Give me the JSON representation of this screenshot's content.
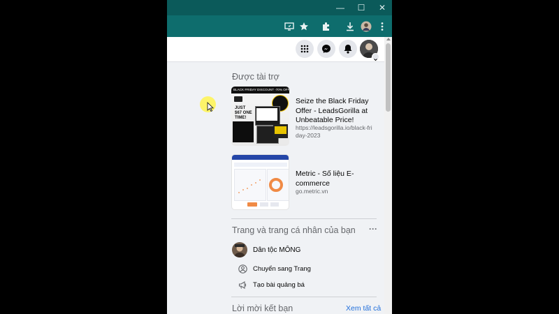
{
  "browser": {
    "window_controls": {
      "minimize": "—",
      "maximize": "☐",
      "close": "✕"
    },
    "toolbar_icons": [
      "install-app-icon",
      "bookmark-star-icon",
      "extensions-icon",
      "download-icon",
      "profile-avatar",
      "menu-icon"
    ],
    "theme_color": "#0e6d6d"
  },
  "facebook_header": {
    "icons": [
      "menu-grid-icon",
      "messenger-icon",
      "notifications-bell-icon",
      "account-avatar"
    ]
  },
  "sponsored": {
    "title": "Được tài trợ",
    "ads": [
      {
        "image_banner": "BLACK FRIDAY DISCOUNT -70% OFF",
        "image_headline": "JUST $67 ONE TIME!",
        "title": "Seize the Black Friday Offer - LeadsGorilla at Unbeatable Price!",
        "url": "https://leadsgorilla.io/black-friday-2023"
      },
      {
        "title": "Metric - Số liệu E-commerce",
        "url": "go.metric.vn"
      }
    ]
  },
  "pages_section": {
    "title": "Trang và trang cá nhân của bạn",
    "more": "···",
    "page_name": "Dân tộc MÔNG",
    "actions": [
      {
        "label": "Chuyển sang Trang",
        "icon": "switch-profile-icon"
      },
      {
        "label": "Tạo bài quảng bá",
        "icon": "megaphone-icon"
      }
    ]
  },
  "friend_requests": {
    "title": "Lời mời kết bạn",
    "see_all": "Xem tất cả",
    "link_color": "#216fdb"
  }
}
